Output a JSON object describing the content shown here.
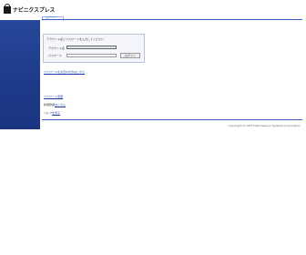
{
  "header": {
    "logo_text": "ナビニクスプレス"
  },
  "tab": {
    "label": "ログイン"
  },
  "login": {
    "message": "アカウント名とパスワードを入力してください",
    "account_label": "アカウント名",
    "password_label": "パスワード",
    "account_value": "",
    "password_value": "",
    "login_button": "ログイン"
  },
  "links": {
    "forgot": "パスワードをお忘れの方はこちら",
    "pw_change": "パスワード変更",
    "register_prefix": "新規登録",
    "register_link": "はこちら",
    "help_prefix": "ヘルプ",
    "help_link": "を見る"
  },
  "footer": {
    "copyright": "Copyright (C) NTT Data Navinix Systems Corporation"
  },
  "colors": {
    "sidebar": "#1e3c8c",
    "rule": "#3a5ec0",
    "link": "#1a3fa8"
  }
}
